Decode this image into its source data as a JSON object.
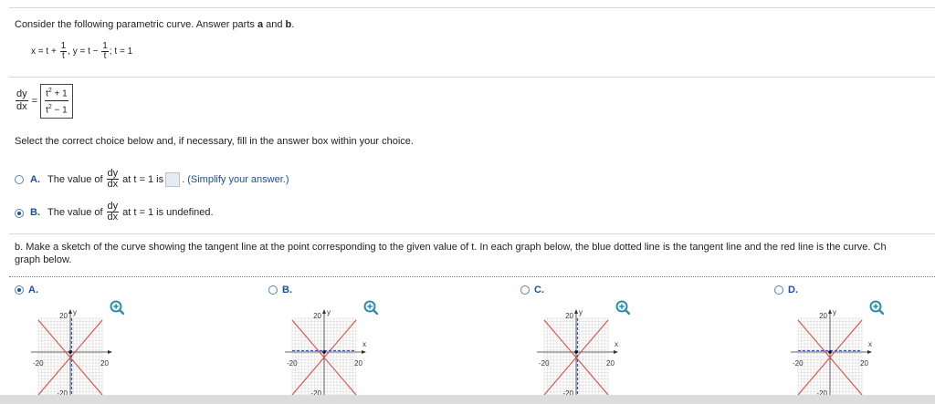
{
  "question": {
    "prompt": "Consider the following parametric curve. Answer parts a and b.",
    "prompt_pre": "Consider the following parametric curve. Answer parts ",
    "part_a": "a",
    "and": " and ",
    "part_b": "b",
    "period": ".",
    "x_eq": "x = t +",
    "y_eq": ", y = t −",
    "frac_num": "1",
    "frac_den": "t",
    "t_val": "; t = 1"
  },
  "derivative": {
    "dy": "dy",
    "dx": "dx",
    "eq": "=",
    "num": "t",
    "num_exp": "2",
    "num_tail": " + 1",
    "den": "t",
    "den_exp": "2",
    "den_tail": " − 1"
  },
  "instruction": "Select the correct choice below and, if necessary, fill in the answer box within your choice.",
  "choices": [
    {
      "letter": "A.",
      "pre": "The value of",
      "mid": "at t = 1 is",
      "post": ". (Simplify your answer.)",
      "selected": false
    },
    {
      "letter": "B.",
      "pre": "The value of",
      "mid": "at t = 1 is undefined.",
      "selected": true
    }
  ],
  "part_b_text": {
    "line1": "b. Make a sketch of the curve showing the tangent line at the point corresponding to the given value of t. In each graph below, the blue dotted line is the tangent line and the red line is the curve. Ch",
    "line2": "graph below."
  },
  "graphs": [
    {
      "letter": "A.",
      "selected": true,
      "tangent": "vertical",
      "y_tick": "20",
      "x_left": "-20",
      "x_right": "20",
      "y_bottom": "-20",
      "x_label": "",
      "y_label": "y"
    },
    {
      "letter": "B.",
      "selected": false,
      "tangent": "horizontal",
      "y_tick": "20",
      "x_left": "-20",
      "x_right": "20",
      "y_bottom": "-20",
      "x_label": "x",
      "y_label": "y"
    },
    {
      "letter": "C.",
      "selected": false,
      "tangent": "vertical",
      "y_tick": "20",
      "x_left": "-20",
      "x_right": "20",
      "y_bottom": "-20",
      "x_label": "x",
      "y_label": "y"
    },
    {
      "letter": "D.",
      "selected": false,
      "tangent": "horizontal",
      "y_tick": "20",
      "x_left": "-20",
      "x_right": "20",
      "y_bottom": "-20",
      "x_label": "x",
      "y_label": "y"
    }
  ],
  "icons": {
    "zoom": "zoom-in-icon"
  },
  "colors": {
    "curve": "#e0403a",
    "tangent": "#3a55d0",
    "accent": "#1b4fa0"
  }
}
